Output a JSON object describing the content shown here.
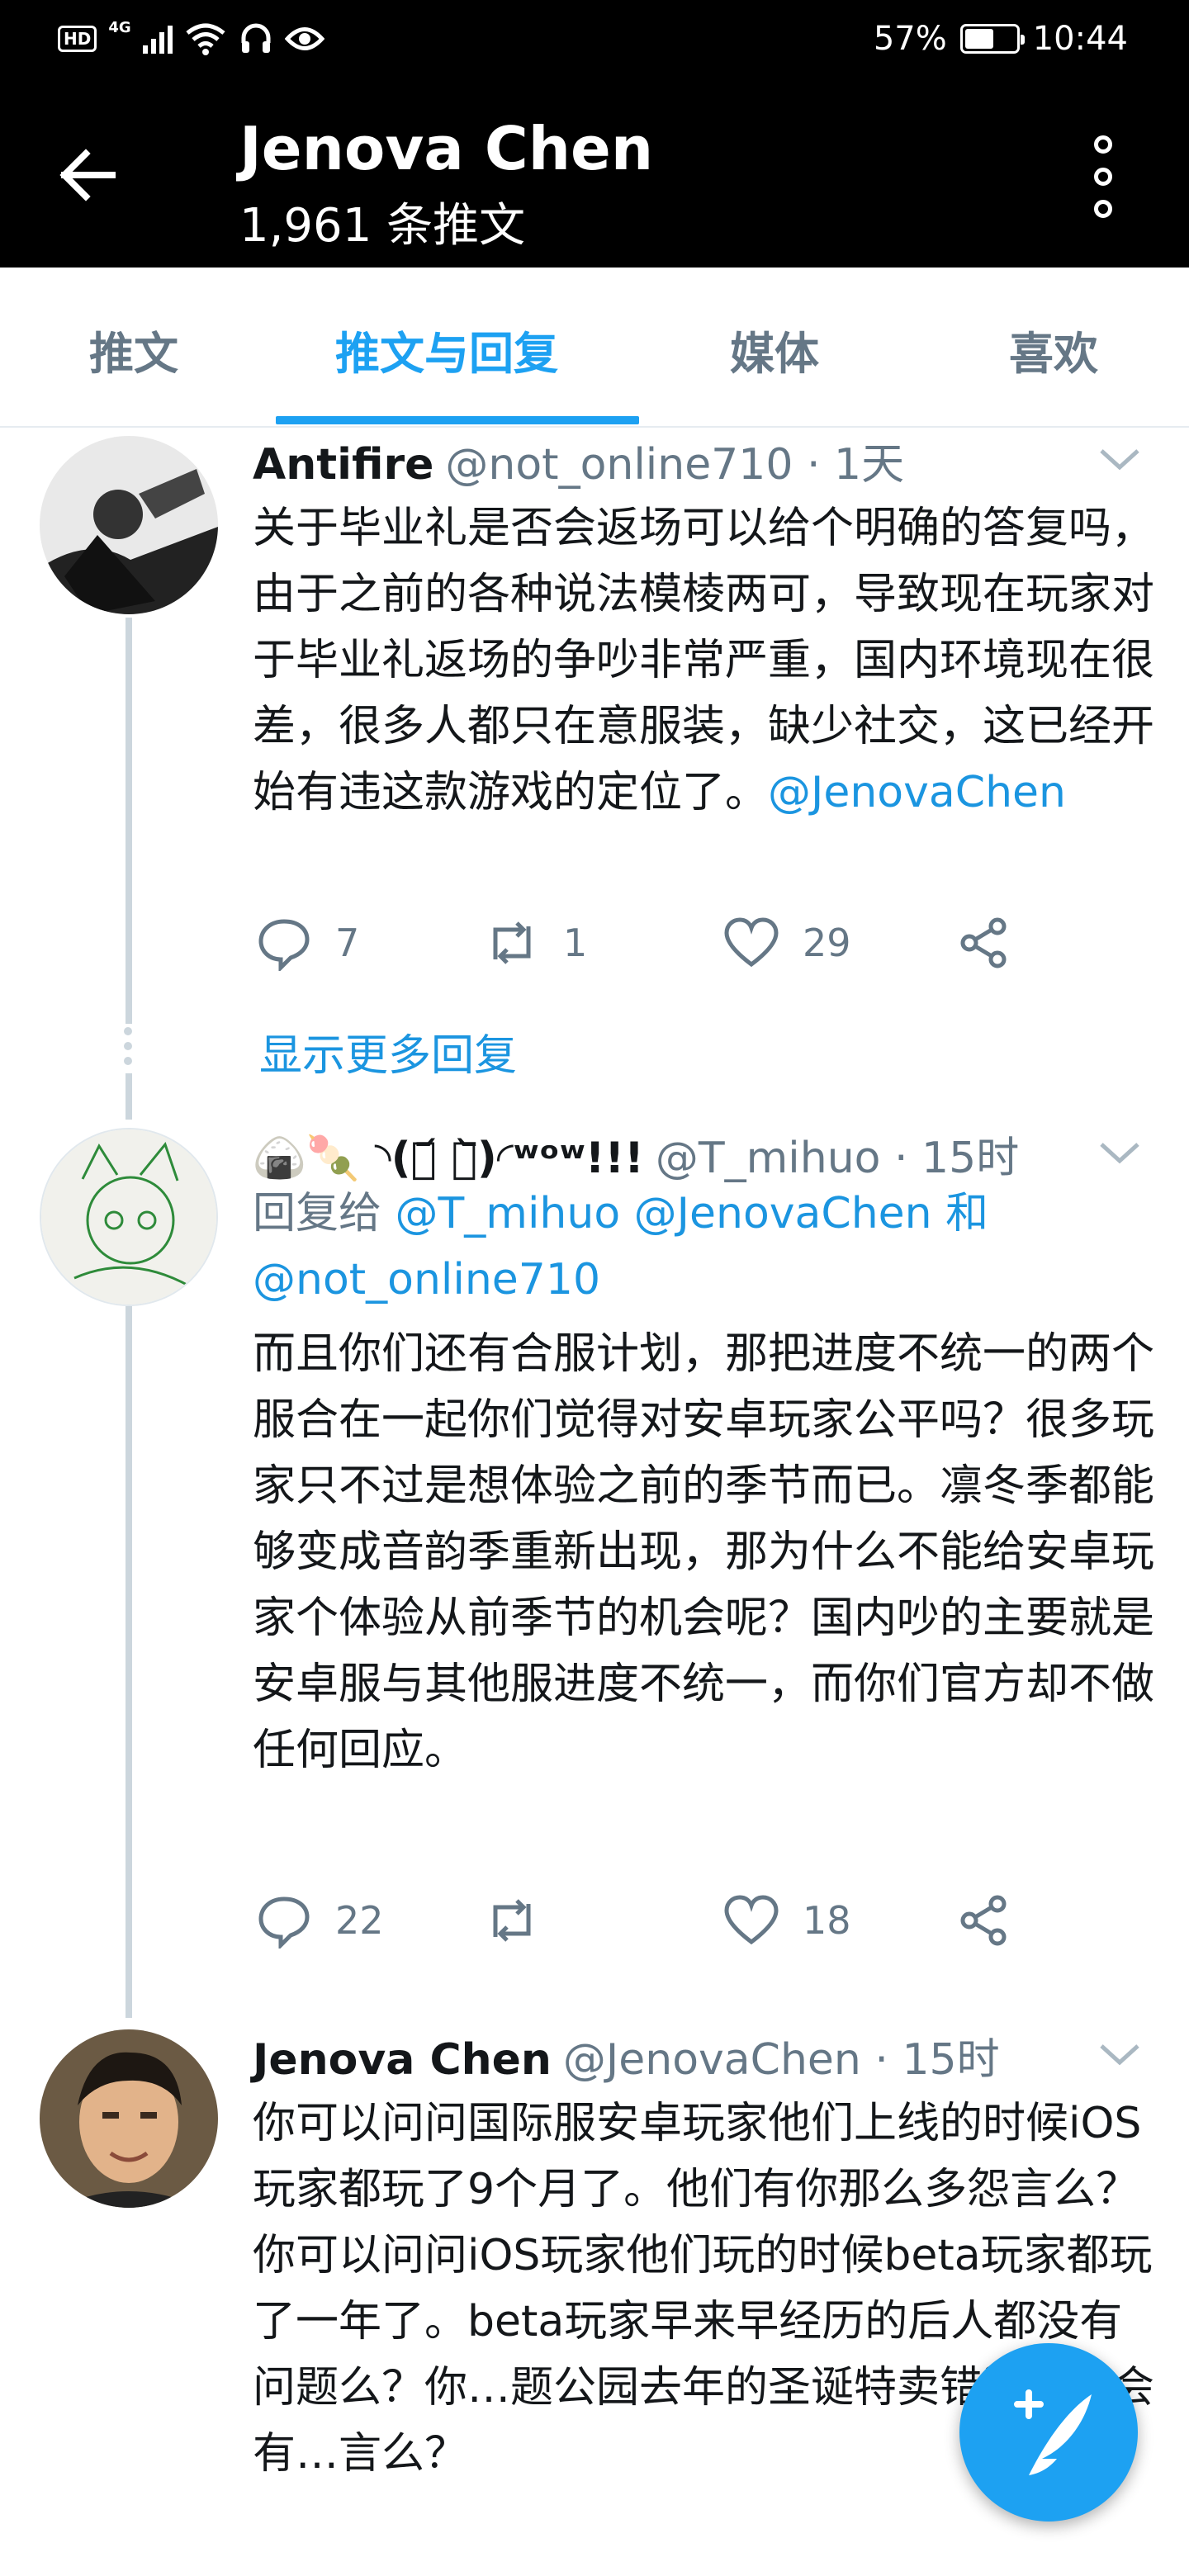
{
  "status_bar": {
    "hd_badge": "HD",
    "network": "4G",
    "battery_percent": "57%",
    "battery_level": 0.57,
    "time": "10:44"
  },
  "header": {
    "title": "Jenova Chen",
    "subtitle": "1,961 条推文",
    "back_icon": "arrow-left-icon",
    "menu_icon": "more-vertical-icon"
  },
  "tabs": [
    {
      "label": "推文",
      "active": false
    },
    {
      "label": "推文与回复",
      "active": true
    },
    {
      "label": "媒体",
      "active": false
    },
    {
      "label": "喜欢",
      "active": false
    }
  ],
  "tweets": [
    {
      "name": "Antifire",
      "handle": "@not_online710 · 1天",
      "text": "关于毕业礼是否会返场可以给个明确的答复吗，由于之前的各种说法模棱两可，导致现在玩家对于毕业礼返场的争吵非常严重，国内环境现在很差，很多人都只在意服装，缺少社交，这已经开始有违这款游戏的定位了。",
      "mention": "@JenovaChen",
      "replies": "7",
      "retweets": "1",
      "likes": "29"
    },
    {
      "name": "🍙🍡 ◝(ㆆ᷄ ㆆ᷅)◜ʷᵒʷ!!!",
      "handle": "@T_mihuo · 15时",
      "reply_prefix": "回复给",
      "reply_handles": "@T_mihuo @JenovaChen 和",
      "reply_handles_2": "@not_online710",
      "text": "而且你们还有合服计划，那把进度不统一的两个服合在一起你们觉得对安卓玩家公平吗？很多玩家只不过是想体验之前的季节而已。凛冬季都能够变成音韵季重新出现，那为什么不能给安卓玩家个体验从前季节的机会呢？国内吵的主要就是安卓服与其他服进度不统一，而你们官方却不做任何回应。",
      "replies": "22",
      "retweets": "",
      "likes": "18"
    },
    {
      "name": "Jenova Chen",
      "handle": "@JenovaChen · 15时",
      "text": "你可以问问国际服安卓玩家他们上线的时候iOS玩家都玩了9个月了。他们有你那么多怨言么？你可以问问iOS玩家他们玩的时候beta玩家都玩了一年了。beta玩家早来早经历的后人都没有问题么？你…题公园去年的圣诞特卖错过了你会有…言么？"
    }
  ],
  "show_more_replies": "显示更多回复",
  "colors": {
    "accent": "#1da1f2",
    "link": "#1b95e0",
    "secondary_text": "#657786",
    "thread_line": "#ccd6dd"
  }
}
